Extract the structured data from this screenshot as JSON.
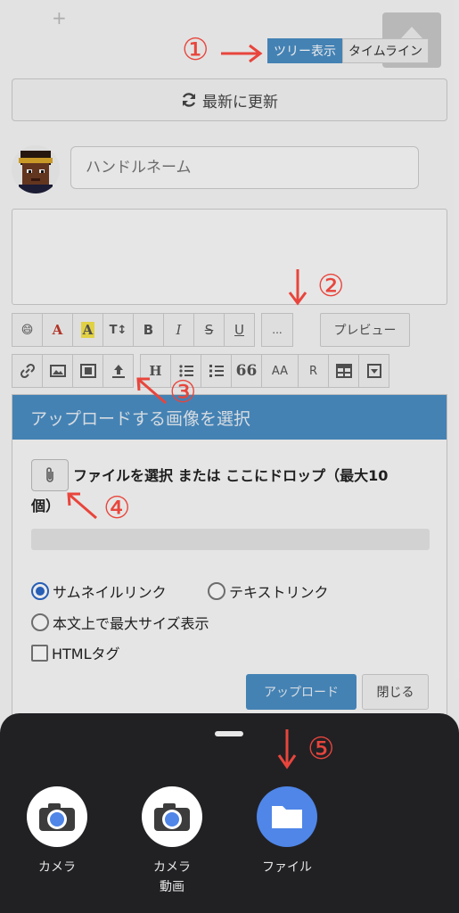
{
  "header": {
    "plus": "+",
    "view_tabs": [
      "ツリー表示",
      "タイムライン"
    ],
    "refresh_label": "最新に更新"
  },
  "form": {
    "handle_placeholder": "ハンドルネーム",
    "toolbar_row1": [
      "😄",
      "A",
      "A",
      "T↕",
      "B",
      "I",
      "S",
      "U"
    ],
    "toolbar_more": "...",
    "preview_label": "プレビュー",
    "toolbar_row2": [
      "link",
      "image",
      "film",
      "upload",
      "H",
      "bullet-list",
      "numbered-list",
      "66",
      "AA",
      "R",
      "table",
      "select"
    ],
    "toolbar_row2_text": {
      "H": "H",
      "quote": "66",
      "aa": "AA",
      "r": "R"
    }
  },
  "upload_panel": {
    "title": "アップロードする画像を選択",
    "drop_text_line1": "ファイルを選択 または ここにドロップ（最大10",
    "drop_text_line2": "個）",
    "options": {
      "thumbnail_link": "サムネイルリンク",
      "text_link": "テキストリンク",
      "full_size": "本文上で最大サイズ表示",
      "html_tag": "HTMLタグ"
    },
    "selected_option": "サムネイルリンク",
    "upload_label": "アップロード",
    "close_label": "閉じる"
  },
  "annotations": {
    "n1": "①",
    "n2": "②",
    "n3": "③",
    "n4": "④",
    "n5": "⑤",
    "color": "#e8453c"
  },
  "bottom_sheet": {
    "apps": [
      {
        "label": "カメラ",
        "icon": "camera-icon"
      },
      {
        "label": "カメラ\n動画",
        "line1": "カメラ",
        "line2": "動画",
        "icon": "camera-icon"
      },
      {
        "label": "ファイル",
        "icon": "folder-icon"
      }
    ]
  },
  "colors": {
    "accent": "#4a8ec4",
    "sheet": "#212124",
    "files": "#4f86e8"
  }
}
